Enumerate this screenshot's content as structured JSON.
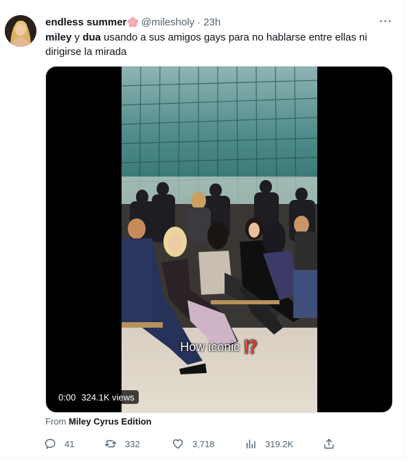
{
  "tweet": {
    "display_name": "endless summer",
    "handle": "@milesholy",
    "separator": "·",
    "time": "23h",
    "more_label": "···",
    "text_bold_1": "miley",
    "text_mid_1": " y ",
    "text_bold_2": "dua",
    "text_rest": " usando a sus amigos gays para no hablarse entre ellas ni dirigirse la mirada"
  },
  "video": {
    "caption": "How iconic ⁉️",
    "time": "0:00",
    "views": "324.1K views"
  },
  "source": {
    "prefix": "From ",
    "name": "Miley Cyrus Edition"
  },
  "actions": {
    "replies": "41",
    "reposts": "332",
    "likes": "3,718",
    "views": "319.2K"
  },
  "colors": {
    "text": "#0f1419",
    "secondary": "#536471",
    "border": "#cfd9de"
  }
}
